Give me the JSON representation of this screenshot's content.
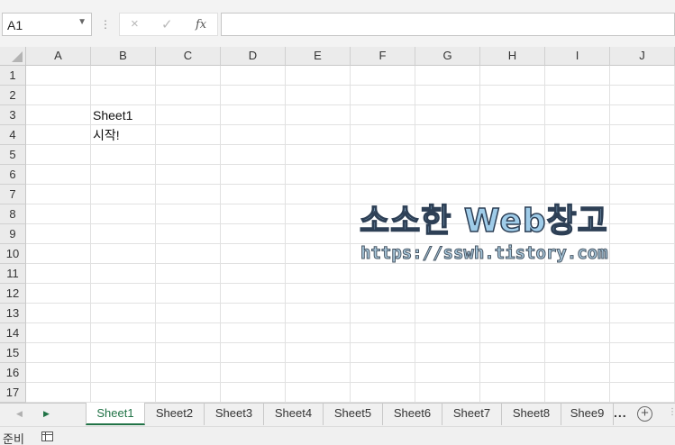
{
  "formula_bar": {
    "name_box": "A1",
    "cancel_icon": "×",
    "enter_icon": "✓",
    "function_icon": "fx",
    "formula": ""
  },
  "columns": [
    "A",
    "B",
    "C",
    "D",
    "E",
    "F",
    "G",
    "H",
    "I",
    "J"
  ],
  "rows": [
    "1",
    "2",
    "3",
    "4",
    "5",
    "6",
    "7",
    "8",
    "9",
    "10",
    "11",
    "12",
    "13",
    "14",
    "15",
    "16",
    "17"
  ],
  "cells": {
    "B3": "Sheet1",
    "B4": "시작!"
  },
  "watermark": {
    "title": "소소한 Web창고",
    "url": "https://sswh.tistory.com"
  },
  "sheet_tabs": {
    "tabs": [
      "Sheet1",
      "Sheet2",
      "Sheet3",
      "Sheet4",
      "Sheet5",
      "Sheet6",
      "Sheet7",
      "Sheet8",
      "Shee9"
    ],
    "active": "Sheet1",
    "more": "...",
    "add": "+"
  },
  "status_bar": {
    "status": "준비"
  },
  "colors": {
    "accent": "#217346",
    "header_bg": "#ebebeb",
    "gridline": "#e1e1e1"
  }
}
